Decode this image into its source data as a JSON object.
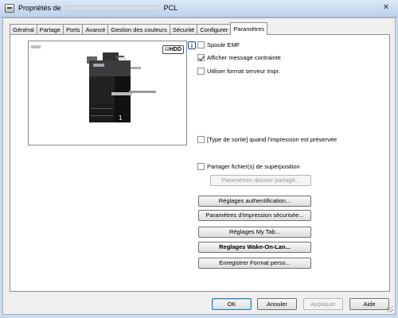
{
  "window": {
    "title_prefix": "Propriétés de",
    "title_suffix": "PCL",
    "close_glyph": "✕"
  },
  "tabs": [
    "Général",
    "Partage",
    "Ports",
    "Avancé",
    "Gestion des couleurs",
    "Sécurité",
    "Configurer",
    "Paramètres"
  ],
  "active_tab": "Paramètres",
  "preview": {
    "badge": "HDD",
    "tray_number": "1"
  },
  "options": {
    "info_glyph": "i",
    "spool_emf": {
      "label": "Spoule EMF",
      "checked": false
    },
    "show_constraint": {
      "label": "Afficher message contrainte",
      "checked": true
    },
    "use_server_format": {
      "label": "Utiliser format serveur impr.",
      "checked": false
    },
    "preserve_output_type": {
      "label": "[Type de sortie] quand l'impression est préservée",
      "checked": false
    },
    "share_overlay": {
      "label": "Partager fichier(s) de superposition",
      "checked": false
    }
  },
  "buttons": {
    "shared_folder_settings": "Paramètres dossier partagé...",
    "auth_settings": "Réglages authentification...",
    "secure_print_settings": "Paramètres d'impression sécurisée...",
    "mytab_settings": "Réglages My Tab...",
    "wake_on_lan": "Reglages Wake-On-Lan...",
    "save_custom_format": "Enregistrer Format perso..."
  },
  "footer": {
    "ok": "OK",
    "cancel": "Annuler",
    "apply": "Appliquer",
    "help": "Aide"
  }
}
